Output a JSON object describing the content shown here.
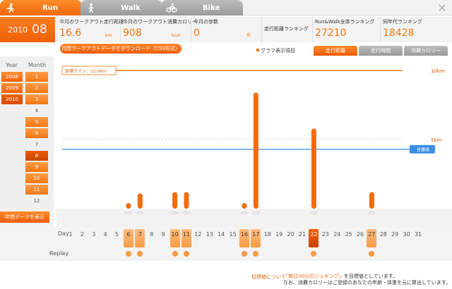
{
  "tabs": [
    {
      "label": "Run",
      "icon": "runner-icon",
      "active": true
    },
    {
      "label": "Walk",
      "icon": "walker-icon",
      "active": false
    },
    {
      "label": "Bike",
      "icon": "bicycle-icon",
      "active": false
    }
  ],
  "date": {
    "year": "2010",
    "month": "08"
  },
  "stats": {
    "distance": {
      "title": "今月のワークアウト走行距離",
      "value": "16.6",
      "unit": "km"
    },
    "calories": {
      "title": "今月のワークアウト消費カロリー",
      "value": "908",
      "unit": "kcal"
    },
    "steps": {
      "title": "今月の歩数",
      "value": "0",
      "unit": "歩"
    },
    "rank_distance": {
      "title": "走行距離ランキング"
    },
    "rank_runwalk": {
      "title": "Run&Walk全体ランキング",
      "value": "27210"
    },
    "rank_age": {
      "title": "同年代ランキング",
      "value": "18428"
    }
  },
  "download_button": "月間ワークアウトデータをダウンロード（CSV形式）",
  "graph": {
    "label": "グラフ表示項目",
    "buttons": [
      "走行距離",
      "走行時間",
      "消費カロリー"
    ]
  },
  "sidebar": {
    "year_header": "Year",
    "month_header": "Month",
    "years": [
      "2008",
      "2009",
      "2010"
    ],
    "selected_year": "2010",
    "months": [
      "1",
      "2",
      "3",
      "4",
      "5",
      "6",
      "7",
      "8",
      "9",
      "10",
      "11",
      "12"
    ],
    "months_with_data": [
      "1",
      "2",
      "3",
      "5",
      "6",
      "8",
      "9",
      "10",
      "11"
    ],
    "selected_month": "8",
    "annual_button": "年間データを表示"
  },
  "chart_data": {
    "type": "bar",
    "x": [
      1,
      2,
      3,
      4,
      5,
      6,
      7,
      8,
      9,
      10,
      11,
      12,
      13,
      14,
      15,
      16,
      17,
      18,
      19,
      20,
      21,
      22,
      23,
      24,
      25,
      26,
      27,
      28,
      29,
      30,
      31
    ],
    "values": [
      0,
      0,
      0,
      0,
      0,
      0.4,
      1.1,
      0,
      0,
      1.2,
      1.2,
      0,
      0,
      0,
      0,
      0.4,
      8.4,
      0,
      0,
      0,
      0,
      5.8,
      0,
      0,
      0,
      0,
      1.2,
      0,
      0,
      0,
      0
    ],
    "ylim": [
      0,
      10
    ],
    "ytick_labels": [
      "5km",
      "10km"
    ],
    "goal_line": {
      "label": "目標ライン：15.0km"
    },
    "target_line": {
      "value": 4.3,
      "label": "目標値",
      "color": "#3a8ee6"
    },
    "bar_color": "#f26b0f"
  },
  "days": {
    "label": "Day",
    "replay_label": "Replay",
    "values": [
      "1",
      "2",
      "3",
      "4",
      "5",
      "6",
      "7",
      "8",
      "9",
      "10",
      "11",
      "12",
      "13",
      "14",
      "15",
      "16",
      "17",
      "18",
      "19",
      "20",
      "21",
      "22",
      "23",
      "24",
      "25",
      "26",
      "27",
      "28",
      "29",
      "30",
      "31"
    ],
    "with_data": [
      "6",
      "7",
      "10",
      "11",
      "16",
      "17",
      "22",
      "27"
    ],
    "selected": "22"
  },
  "footer": {
    "link": "目標値について",
    "line1_pre": "「毎日30分のジョギング」",
    "line1_post": "を目標値としています。",
    "line2": "なお、消費カロリーはご登録のあなたの年齢・体重を元に算出しています。"
  }
}
